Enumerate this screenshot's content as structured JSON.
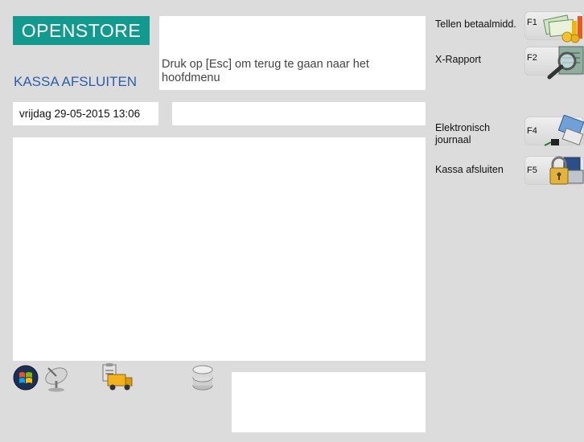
{
  "header": {
    "logo_text": "OPENSTORE",
    "screen_title": "KASSA AFSLUITEN",
    "message": "Druk op [Esc] om terug te gaan naar het hoofdmenu",
    "datetime": "vrijdag 29-05-2015 13:06"
  },
  "functions": [
    {
      "label": "Tellen betaalmidd.",
      "key": "F1",
      "icon": "cash-coins-icon"
    },
    {
      "label": "X-Rapport",
      "key": "F2",
      "icon": "magnifier-report-icon"
    },
    {
      "label": "Elektronisch journaal",
      "key": "F4",
      "icon": "journal-network-icon"
    },
    {
      "label": "Kassa afsluiten",
      "key": "F5",
      "icon": "register-lock-icon"
    }
  ],
  "tray": [
    "windows-icon",
    "satellite-dish-icon",
    "delivery-truck-icon",
    "database-icon"
  ],
  "colors": {
    "brand": "#139a8e",
    "title": "#2c5ea8",
    "background": "#dcdcdc"
  }
}
